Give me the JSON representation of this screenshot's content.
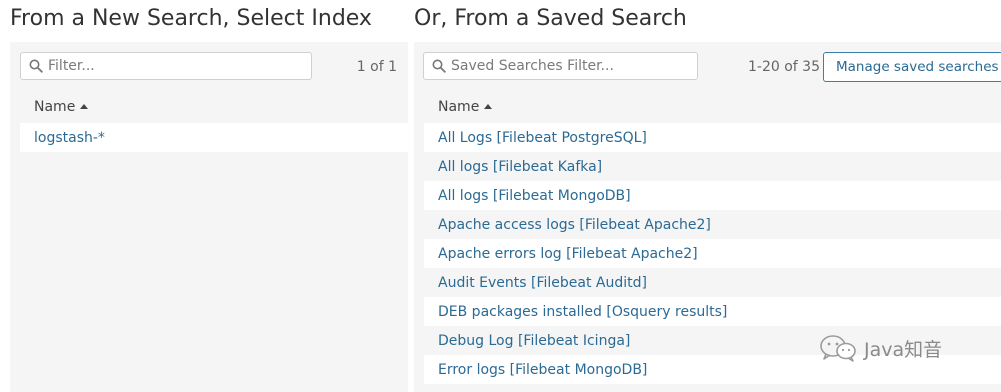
{
  "left": {
    "title": "From a New Search, Select Index",
    "filter_placeholder": "Filter...",
    "pager": "1 of 1",
    "column_header": "Name",
    "items": [
      {
        "label": "logstash-*"
      }
    ]
  },
  "right": {
    "title": "Or, From a Saved Search",
    "filter_placeholder": "Saved Searches Filter...",
    "pager": "1-20 of 35",
    "manage_button": "Manage saved searches",
    "column_header": "Name",
    "items": [
      {
        "label": "All Logs [Filebeat PostgreSQL]"
      },
      {
        "label": "All logs [Filebeat Kafka]"
      },
      {
        "label": "All logs [Filebeat MongoDB]"
      },
      {
        "label": "Apache access logs [Filebeat Apache2]"
      },
      {
        "label": "Apache errors log [Filebeat Apache2]"
      },
      {
        "label": "Audit Events [Filebeat Auditd]"
      },
      {
        "label": "DEB packages installed [Osquery results]"
      },
      {
        "label": "Debug Log [Filebeat Icinga]"
      },
      {
        "label": "Error logs [Filebeat MongoDB]"
      }
    ]
  },
  "watermark": {
    "text": "Java知音",
    "icon": "wechat-icon"
  },
  "colors": {
    "link": "#2b6a94",
    "panel_bg": "#f5f5f5",
    "button_border": "#3a7fae"
  }
}
